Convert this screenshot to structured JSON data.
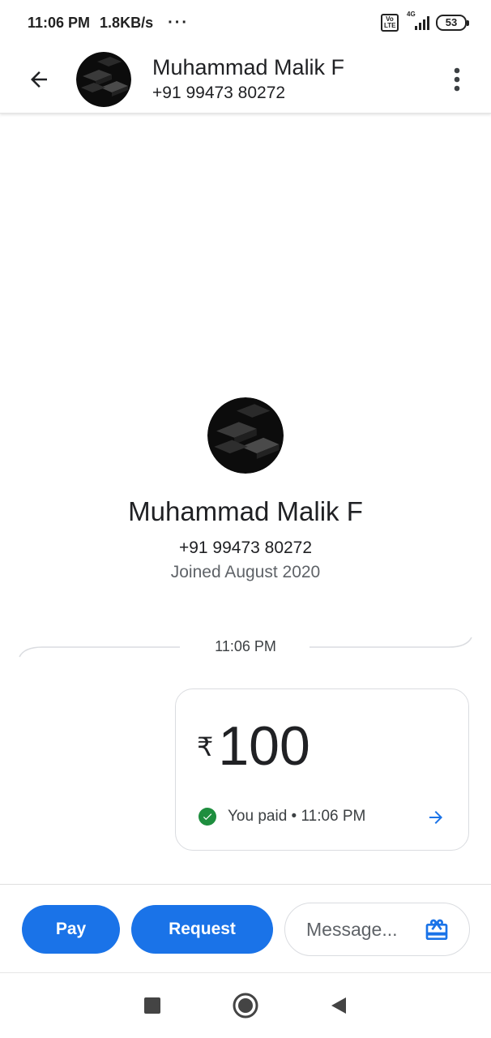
{
  "status_bar": {
    "time": "11:06 PM",
    "speed": "1.8KB/s",
    "dots": "···",
    "volte_label": "Vo LTE",
    "network": "4G",
    "battery": "53"
  },
  "header": {
    "name": "Muhammad Malik F",
    "phone": "+91 99473 80272"
  },
  "profile": {
    "name": "Muhammad Malik F",
    "phone": "+91 99473 80272",
    "joined": "Joined August 2020"
  },
  "conversation": {
    "divider_time": "11:06 PM",
    "payment": {
      "currency": "₹",
      "amount": "100",
      "status_text": "You paid • 11:06 PM"
    }
  },
  "actions": {
    "pay_label": "Pay",
    "request_label": "Request",
    "message_placeholder": "Message..."
  },
  "colors": {
    "accent": "#1a73e8",
    "success": "#1e8e3e"
  },
  "icons": [
    "back-arrow-icon",
    "more-vert-icon",
    "check-circle-icon",
    "arrow-right-icon",
    "gift-icon",
    "nav-recents-icon",
    "nav-home-icon",
    "nav-back-icon"
  ]
}
